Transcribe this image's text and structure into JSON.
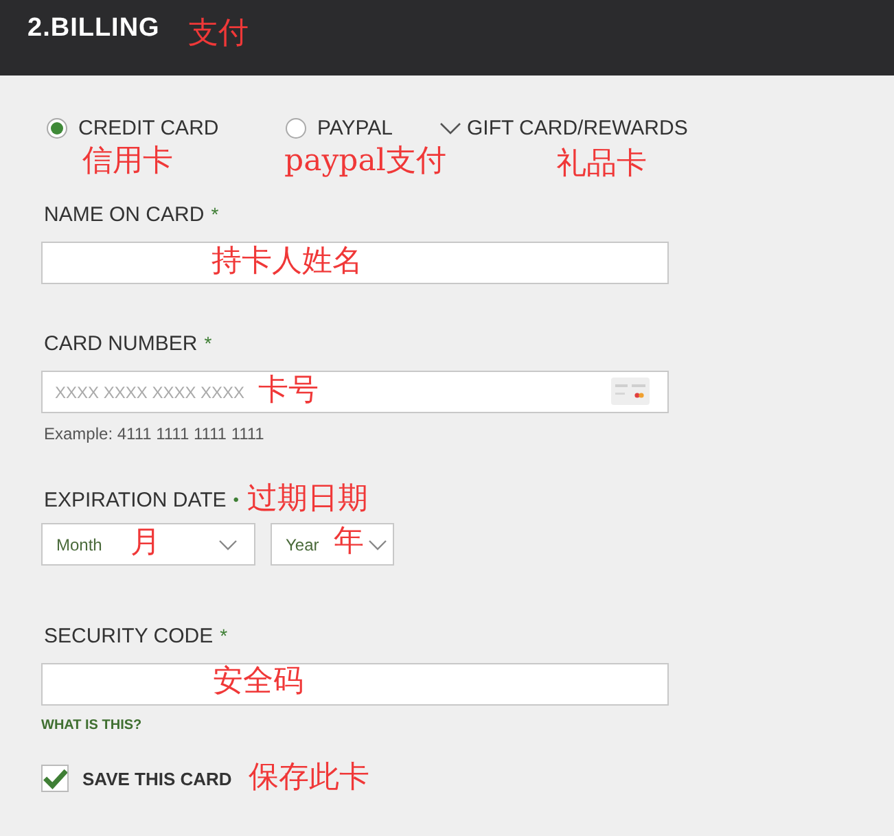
{
  "header": {
    "title": "2.BILLING",
    "annotation": "支付"
  },
  "payment_methods": [
    {
      "label": "CREDIT CARD",
      "selected": true,
      "annotation": "信用卡"
    },
    {
      "label": "PAYPAL",
      "selected": false,
      "annotation": "paypal支付"
    }
  ],
  "gift_card": {
    "label": "GIFT CARD/REWARDS",
    "expanded": false,
    "annotation": "礼品卡"
  },
  "name_on_card": {
    "label": "NAME ON CARD",
    "required_mark": "*",
    "annotation": "持卡人姓名"
  },
  "card_number": {
    "label": "CARD NUMBER",
    "required_mark": "*",
    "placeholder": "XXXX XXXX XXXX XXXX",
    "annotation": "卡号",
    "hint": "Example: 4111 1111 1111 1111"
  },
  "expiration": {
    "label": "EXPIRATION DATE",
    "required_mark": "•",
    "annotation": "过期日期",
    "selects": [
      {
        "placeholder": "Month",
        "annotation": "月"
      },
      {
        "placeholder": "Year",
        "annotation": "年"
      }
    ]
  },
  "security_code": {
    "label": "SECURITY CODE",
    "required_mark": "*",
    "annotation": "安全码",
    "help_link": "WHAT IS THIS?"
  },
  "save_card": {
    "label": "SAVE THIS CARD",
    "checked": true,
    "annotation": "保存此卡"
  }
}
